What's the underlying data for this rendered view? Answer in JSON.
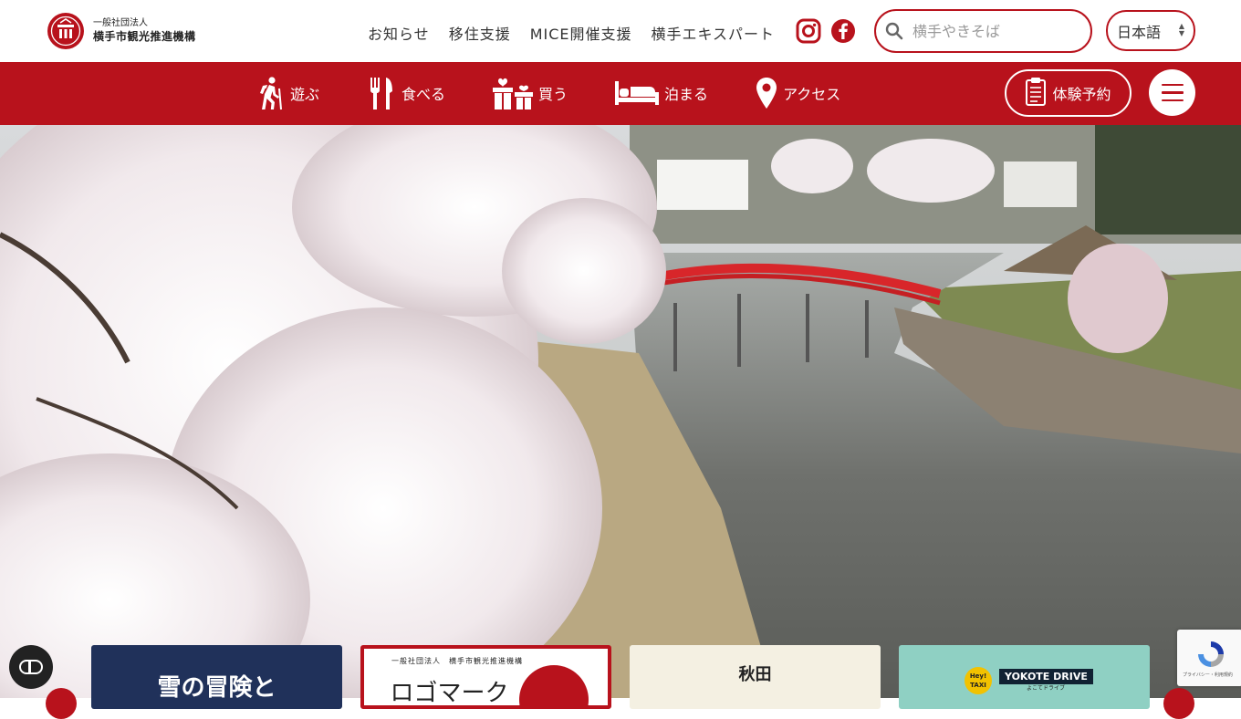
{
  "header": {
    "logo_sub": "一般社団法人",
    "logo_main": "横手市観光推進機構",
    "nav": [
      {
        "label": "お知らせ"
      },
      {
        "label": "移住支援"
      },
      {
        "label": "MICE開催支援"
      },
      {
        "label": "横手エキスパート"
      }
    ],
    "social": [
      {
        "icon": "instagram-icon"
      },
      {
        "icon": "facebook-icon"
      }
    ],
    "search": {
      "placeholder": "横手やきそば",
      "value": ""
    },
    "language": {
      "selected": "日本語"
    }
  },
  "main_nav": {
    "items": [
      {
        "label": "遊ぶ",
        "icon": "hiking-icon"
      },
      {
        "label": "食べる",
        "icon": "fork-knife-icon"
      },
      {
        "label": "買う",
        "icon": "gift-icon"
      },
      {
        "label": "泊まる",
        "icon": "bed-icon"
      },
      {
        "label": "アクセス",
        "icon": "map-pin-icon"
      }
    ],
    "book_label": "体験予約"
  },
  "cards": [
    {
      "title": "雪の冒険と"
    },
    {
      "sub": "一般社団法人　横手市観光推進機構",
      "title": "ロゴマーク"
    },
    {
      "title": "秋田"
    },
    {
      "badge": "Hey! TAXI",
      "title": "YOKOTE DRIVE",
      "caption": "よこてドライブ"
    }
  ],
  "recaptcha": {
    "text": "プライバシー・利用規約"
  },
  "colors": {
    "brand": "#b8121c",
    "white": "#ffffff"
  }
}
